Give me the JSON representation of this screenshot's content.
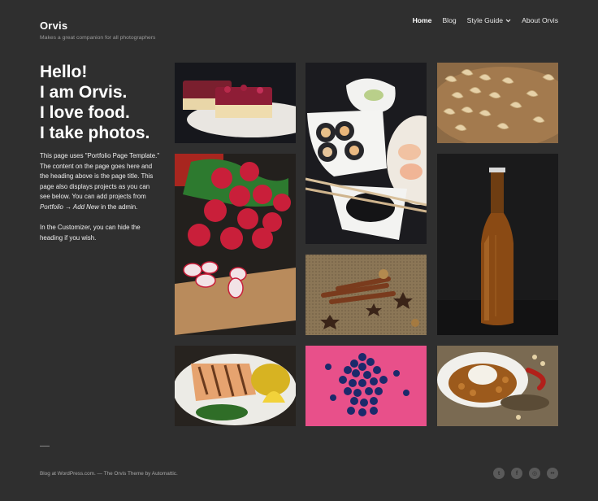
{
  "site": {
    "title": "Orvis",
    "description": "Makes a great companion for all photographers"
  },
  "nav": {
    "items": [
      {
        "label": "Home"
      },
      {
        "label": "Blog"
      },
      {
        "label": "Style Guide"
      },
      {
        "label": "About Orvis"
      }
    ],
    "dropdown_glyph": "⌄"
  },
  "page": {
    "heading_lines": [
      "Hello!",
      "I am Orvis.",
      "I love food.",
      "I take photos."
    ],
    "intro_p1_a": "This page uses \"Portfolio Page Template.\" The content on the page goes here and the heading above is the page title. This page also displays projects as you can see below. You can add projects from ",
    "intro_p1_em": "Portfolio → Add New",
    "intro_p1_b": " in the admin.",
    "intro_p2": "In the Customizer, you can hide the heading if you wish."
  },
  "portfolio": {
    "items": [
      {
        "subject": "berry cake on plate"
      },
      {
        "subject": "sushi rolls with chopsticks"
      },
      {
        "subject": "cashew nuts on wooden plate"
      },
      {
        "subject": "radishes on cutting board"
      },
      {
        "subject": "beer bottle"
      },
      {
        "subject": "cinnamon sticks and star anise"
      },
      {
        "subject": "grilled salmon with lemon"
      },
      {
        "subject": "blueberries on pink background"
      },
      {
        "subject": "curry with rice"
      }
    ]
  },
  "footer": {
    "credit": "Blog at WordPress.com. — The Orvis Theme by Automattic.",
    "social": [
      {
        "icon": "twitter-icon",
        "glyph": "t"
      },
      {
        "icon": "facebook-icon",
        "glyph": "f"
      },
      {
        "icon": "instagram-icon",
        "glyph": "◎"
      },
      {
        "icon": "flickr-icon",
        "glyph": "••"
      }
    ]
  },
  "colors": {
    "background": "#2f2f2f",
    "text": "#ffffff",
    "muted": "#9a9a9a"
  }
}
